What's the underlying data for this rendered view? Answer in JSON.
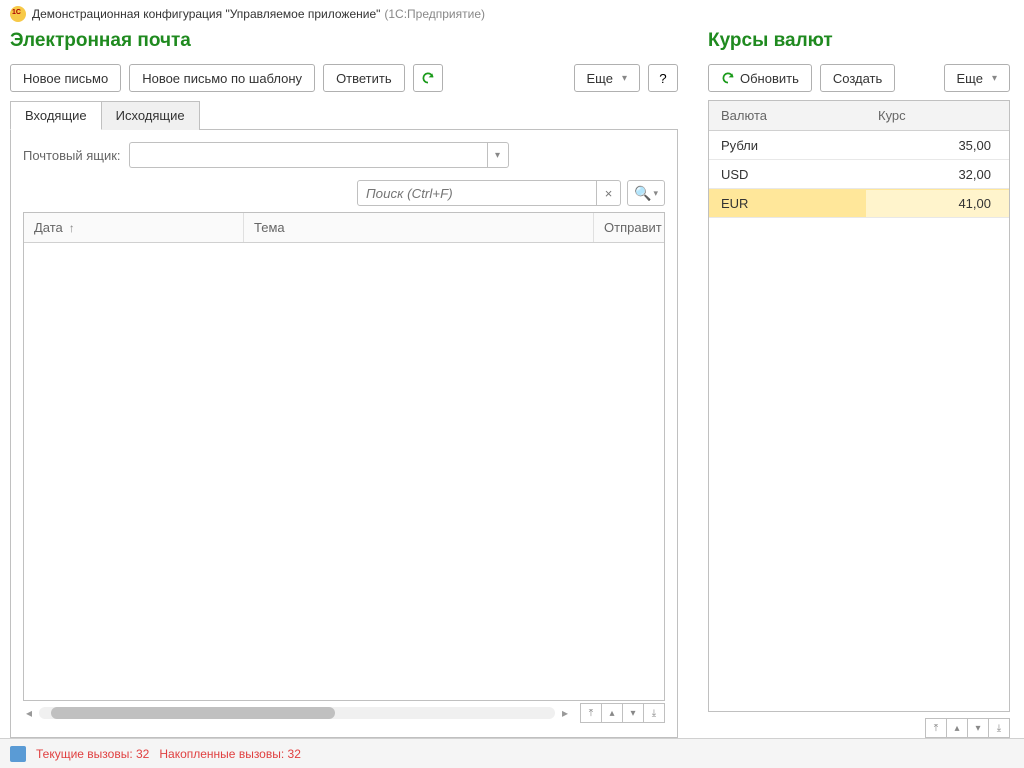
{
  "titlebar": {
    "main": "Демонстрационная конфигурация \"Управляемое приложение\"",
    "app": "(1С:Предприятие)"
  },
  "email": {
    "title": "Электронная почта",
    "buttons": {
      "new": "Новое письмо",
      "new_template": "Новое письмо по шаблону",
      "reply": "Ответить",
      "more": "Еще",
      "help": "?"
    },
    "tabs": [
      {
        "label": "Входящие",
        "active": true
      },
      {
        "label": "Исходящие",
        "active": false
      }
    ],
    "mailbox_label": "Почтовый ящик:",
    "mailbox_value": "",
    "search_placeholder": "Поиск (Ctrl+F)",
    "columns": {
      "date": "Дата",
      "subject": "Тема",
      "sender": "Отправит"
    }
  },
  "currency": {
    "title": "Курсы валют",
    "buttons": {
      "refresh": "Обновить",
      "create": "Создать",
      "more": "Еще"
    },
    "columns": {
      "currency": "Валюта",
      "rate": "Курс"
    },
    "rows": [
      {
        "name": "Рубли",
        "rate": "35,00",
        "selected": false
      },
      {
        "name": "USD",
        "rate": "32,00",
        "selected": false
      },
      {
        "name": "EUR",
        "rate": "41,00",
        "selected": true
      }
    ]
  },
  "status": {
    "current": "Текущие вызовы: 32",
    "accum": "Накопленные вызовы: 32"
  }
}
